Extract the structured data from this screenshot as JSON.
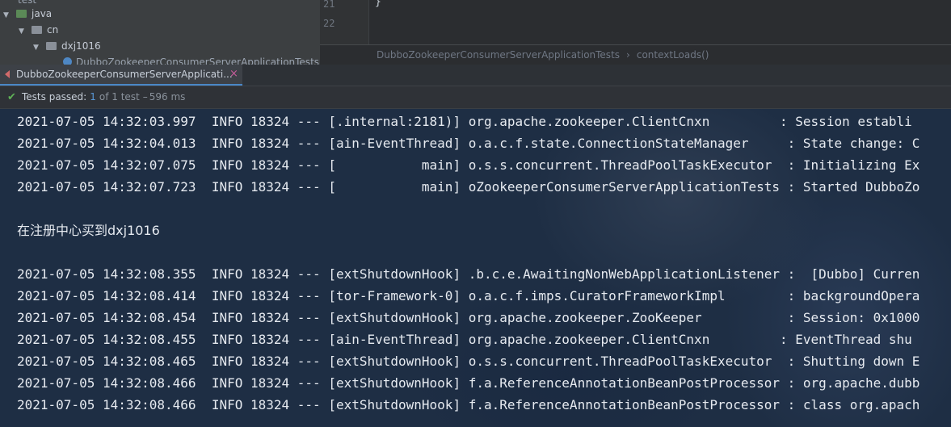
{
  "project_tree": {
    "items": [
      {
        "label": "test",
        "level": 0
      },
      {
        "label": "java",
        "level": 0
      },
      {
        "label": "cn",
        "level": 1
      },
      {
        "label": "dxj1016",
        "level": 2
      },
      {
        "label": "DubboZookeeperConsumerServerApplicationTests",
        "level": 3
      }
    ]
  },
  "editor": {
    "line_numbers": [
      "21",
      "22"
    ],
    "code_line": "}",
    "breadcrumb": [
      "DubboZookeeperConsumerServerApplicationTests",
      "contextLoads()"
    ],
    "breadcrumb_separator": "›"
  },
  "run_tab": {
    "label": "DubboZookeeperConsumerServerApplicati...",
    "close": "×"
  },
  "test_status": {
    "label": "Tests passed:",
    "passed_count": "1",
    "of_total": "of 1 test",
    "dash": "–",
    "duration": "596 ms"
  },
  "console": {
    "lines": [
      "2021-07-05 14:32:03.997  INFO 18324 --- [.internal:2181)] org.apache.zookeeper.ClientCnxn         : Session establi",
      "2021-07-05 14:32:04.013  INFO 18324 --- [ain-EventThread] o.a.c.f.state.ConnectionStateManager     : State change: C",
      "2021-07-05 14:32:07.075  INFO 18324 --- [           main] o.s.s.concurrent.ThreadPoolTaskExecutor  : Initializing Ex",
      "2021-07-05 14:32:07.723  INFO 18324 --- [           main] oZookeeperConsumerServerApplicationTests : Started DubboZo",
      "",
      "在注册中心买到dxj1016",
      "",
      "2021-07-05 14:32:08.355  INFO 18324 --- [extShutdownHook] .b.c.e.AwaitingNonWebApplicationListener :  [Dubbo] Curren",
      "2021-07-05 14:32:08.414  INFO 18324 --- [tor-Framework-0] o.a.c.f.imps.CuratorFrameworkImpl        : backgroundOpera",
      "2021-07-05 14:32:08.454  INFO 18324 --- [extShutdownHook] org.apache.zookeeper.ZooKeeper           : Session: 0x1000",
      "2021-07-05 14:32:08.455  INFO 18324 --- [ain-EventThread] org.apache.zookeeper.ClientCnxn         : EventThread shu",
      "2021-07-05 14:32:08.465  INFO 18324 --- [extShutdownHook] o.s.s.concurrent.ThreadPoolTaskExecutor  : Shutting down E",
      "2021-07-05 14:32:08.466  INFO 18324 --- [extShutdownHook] f.a.ReferenceAnnotationBeanPostProcessor : org.apache.dubb",
      "2021-07-05 14:32:08.466  INFO 18324 --- [extShutdownHook] f.a.ReferenceAnnotationBeanPostProcessor : class org.apach"
    ]
  }
}
